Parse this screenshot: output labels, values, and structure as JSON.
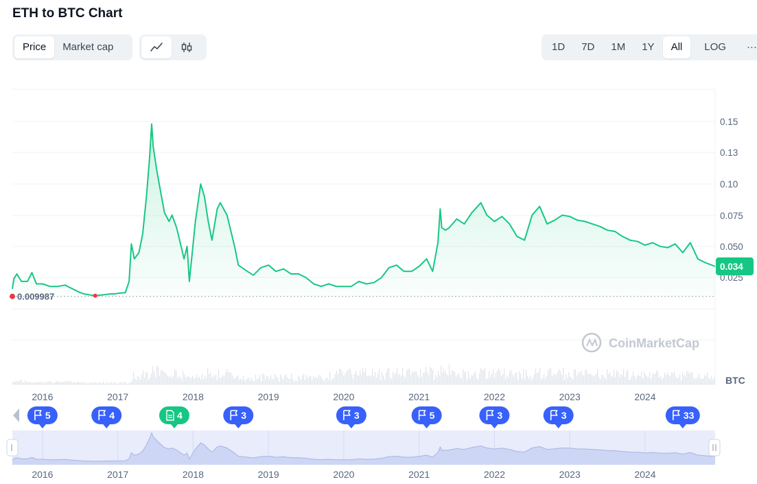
{
  "header": {
    "title": "ETH to BTC Chart"
  },
  "toolbar": {
    "view_tabs": [
      {
        "label": "Price",
        "active": true
      },
      {
        "label": "Market cap",
        "active": false
      }
    ],
    "chart_style": {
      "active": "line",
      "icons": [
        "line-chart-icon",
        "candlestick-icon"
      ]
    },
    "ranges": [
      {
        "label": "1D",
        "active": false
      },
      {
        "label": "7D",
        "active": false
      },
      {
        "label": "1M",
        "active": false
      },
      {
        "label": "1Y",
        "active": false
      },
      {
        "label": "All",
        "active": true
      }
    ],
    "log_label": "LOG",
    "more_label": "···"
  },
  "watermark": "CoinMarketCap",
  "colors": {
    "line": "#16c784",
    "low_marker": "#ea3943",
    "event_blue": "#3861fb",
    "event_green": "#16c784",
    "navigator_fill": "#e8ecfb"
  },
  "chart_data": {
    "type": "line",
    "title": "ETH to BTC Chart",
    "unit": "BTC",
    "x_ticks": [
      "2016",
      "2017",
      "2018",
      "2019",
      "2020",
      "2021",
      "2022",
      "2023",
      "2024"
    ],
    "y_ticks": [
      "0.15",
      "0.13",
      "0.10",
      "0.075",
      "0.050",
      "0.025"
    ],
    "xlim": [
      2015.6,
      2024.93
    ],
    "current_value": 0.034,
    "current_label": "0.034",
    "low_value": 0.009987,
    "low_label": "0.009987",
    "series": [
      {
        "x": [
          2015.6,
          2015.62,
          2015.66,
          2015.72,
          2015.8,
          2015.86,
          2015.92,
          2016.0,
          2016.1,
          2016.2,
          2016.3,
          2016.4,
          2016.5,
          2016.55,
          2016.7,
          2016.82,
          2016.9,
          2016.96,
          2017.0,
          2017.1,
          2017.15,
          2017.18,
          2017.22,
          2017.28,
          2017.33,
          2017.38,
          2017.42,
          2017.45,
          2017.47,
          2017.52,
          2017.58,
          2017.62,
          2017.68,
          2017.72,
          2017.78,
          2017.82,
          2017.88,
          2017.92,
          2017.95,
          2017.98,
          2018.03,
          2018.1,
          2018.15,
          2018.2,
          2018.25,
          2018.32,
          2018.36,
          2018.45,
          2018.55,
          2018.6,
          2018.72,
          2018.8,
          2018.9,
          2019.0,
          2019.1,
          2019.2,
          2019.3,
          2019.4,
          2019.5,
          2019.6,
          2019.7,
          2019.8,
          2019.9,
          2020.0,
          2020.1,
          2020.2,
          2020.3,
          2020.4,
          2020.5,
          2020.6,
          2020.7,
          2020.8,
          2020.9,
          2021.0,
          2021.1,
          2021.18,
          2021.25,
          2021.28,
          2021.3,
          2021.35,
          2021.4,
          2021.5,
          2021.6,
          2021.7,
          2021.82,
          2021.9,
          2022.0,
          2022.1,
          2022.2,
          2022.3,
          2022.4,
          2022.5,
          2022.6,
          2022.7,
          2022.8,
          2022.9,
          2023.0,
          2023.1,
          2023.2,
          2023.3,
          2023.4,
          2023.5,
          2023.6,
          2023.7,
          2023.8,
          2023.9,
          2024.0,
          2024.1,
          2024.2,
          2024.3,
          2024.4,
          2024.5,
          2024.6,
          2024.7,
          2024.8,
          2024.93
        ],
        "y": [
          0.016,
          0.024,
          0.028,
          0.022,
          0.022,
          0.029,
          0.02,
          0.02,
          0.018,
          0.018,
          0.019,
          0.016,
          0.013,
          0.012,
          0.0105,
          0.0113,
          0.012,
          0.012,
          0.0125,
          0.013,
          0.022,
          0.052,
          0.04,
          0.045,
          0.06,
          0.09,
          0.12,
          0.148,
          0.13,
          0.11,
          0.09,
          0.077,
          0.07,
          0.075,
          0.065,
          0.055,
          0.04,
          0.05,
          0.022,
          0.04,
          0.07,
          0.1,
          0.09,
          0.07,
          0.055,
          0.08,
          0.085,
          0.075,
          0.05,
          0.035,
          0.03,
          0.027,
          0.033,
          0.035,
          0.03,
          0.032,
          0.028,
          0.028,
          0.025,
          0.02,
          0.018,
          0.02,
          0.018,
          0.018,
          0.018,
          0.022,
          0.02,
          0.021,
          0.025,
          0.033,
          0.035,
          0.03,
          0.03,
          0.034,
          0.04,
          0.03,
          0.053,
          0.08,
          0.065,
          0.063,
          0.065,
          0.072,
          0.068,
          0.077,
          0.085,
          0.075,
          0.07,
          0.074,
          0.068,
          0.058,
          0.055,
          0.075,
          0.082,
          0.068,
          0.071,
          0.075,
          0.074,
          0.071,
          0.07,
          0.068,
          0.066,
          0.063,
          0.062,
          0.058,
          0.055,
          0.054,
          0.051,
          0.053,
          0.05,
          0.049,
          0.052,
          0.045,
          0.053,
          0.04,
          0.037,
          0.034
        ]
      }
    ],
    "events": [
      {
        "year": 2016.0,
        "count": "5",
        "kind": "flag"
      },
      {
        "year": 2016.85,
        "count": "4",
        "kind": "flag"
      },
      {
        "year": 2017.75,
        "count": "4",
        "kind": "doc"
      },
      {
        "year": 2018.6,
        "count": "3",
        "kind": "flag"
      },
      {
        "year": 2020.1,
        "count": "3",
        "kind": "flag"
      },
      {
        "year": 2021.1,
        "count": "5",
        "kind": "flag"
      },
      {
        "year": 2022.0,
        "count": "3",
        "kind": "flag"
      },
      {
        "year": 2022.85,
        "count": "3",
        "kind": "flag"
      },
      {
        "year": 2024.5,
        "count": "33",
        "kind": "flag"
      }
    ]
  }
}
